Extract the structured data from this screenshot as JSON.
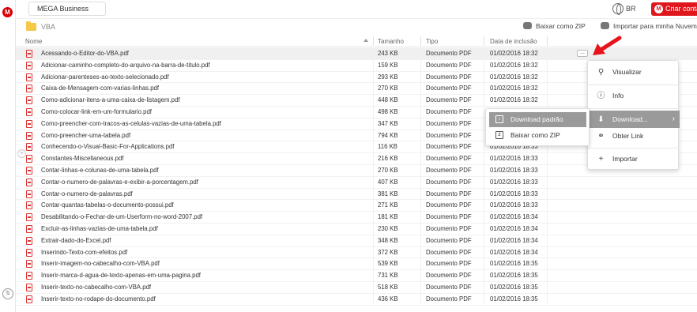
{
  "app": {
    "logo_letter": "M"
  },
  "topbar": {
    "account_tab": "MEGA Business",
    "language": "BR",
    "create_account": "Criar conta"
  },
  "breadcrumb": {
    "folder": "VBA"
  },
  "actions": {
    "download_zip": "Baixar como ZIP",
    "import": "Importar para minha Nuvem"
  },
  "columns": {
    "name": "Nome",
    "size": "Tamanho",
    "type": "Tipo",
    "date": "Data de inclusão"
  },
  "files": [
    {
      "name": "Acessando-o-Editor-do-VBA.pdf",
      "size": "243 KB",
      "type": "Documento PDF",
      "date": "01/02/2016 18:32"
    },
    {
      "name": "Adicionar-caminho-completo-do-arquivo-na-barra-de-titulo.pdf",
      "size": "159 KB",
      "type": "Documento PDF",
      "date": "01/02/2016 18:32"
    },
    {
      "name": "Adicionar-parenteses-ao-texto-selecionado.pdf",
      "size": "293 KB",
      "type": "Documento PDF",
      "date": "01/02/2016 18:32"
    },
    {
      "name": "Caixa-de-Mensagem-com-varias-linhas.pdf",
      "size": "270 KB",
      "type": "Documento PDF",
      "date": "01/02/2016 18:32"
    },
    {
      "name": "Como-adicionar-itens-a-uma-caixa-de-listagem.pdf",
      "size": "448 KB",
      "type": "Documento PDF",
      "date": "01/02/2016 18:32"
    },
    {
      "name": "Como-colocar-link-em-um-formulario.pdf",
      "size": "498 KB",
      "type": "Documento PDF",
      "date": "01/02/2016 18:32"
    },
    {
      "name": "Como-preencher-com-tracos-as-celulas-vazias-de-uma-tabela.pdf",
      "size": "347 KB",
      "type": "Documento PDF",
      "date": "01/02/2016 18:32"
    },
    {
      "name": "Como-preencher-uma-tabela.pdf",
      "size": "794 KB",
      "type": "Documento PDF",
      "date": "01/02/2016 18:32"
    },
    {
      "name": "Conhecendo-o-Visual-Basic-For-Applications.pdf",
      "size": "116 KB",
      "type": "Documento PDF",
      "date": "01/02/2016 18:33"
    },
    {
      "name": "Constantes-Miscellaneous.pdf",
      "size": "216 KB",
      "type": "Documento PDF",
      "date": "01/02/2016 18:33"
    },
    {
      "name": "Contar-linhas-e-colunas-de-uma-tabela.pdf",
      "size": "270 KB",
      "type": "Documento PDF",
      "date": "01/02/2016 18:33"
    },
    {
      "name": "Contar-o-numero-de-palavras-e-exibir-a-porcentagem.pdf",
      "size": "407 KB",
      "type": "Documento PDF",
      "date": "01/02/2016 18:33"
    },
    {
      "name": "Contar-o-numero-de-palavras.pdf",
      "size": "381 KB",
      "type": "Documento PDF",
      "date": "01/02/2016 18:33"
    },
    {
      "name": "Contar-quantas-tabelas-o-documento-possui.pdf",
      "size": "271 KB",
      "type": "Documento PDF",
      "date": "01/02/2016 18:33"
    },
    {
      "name": "Desabilitando-o-Fechar-de-um-Userform-no-word-2007.pdf",
      "size": "181 KB",
      "type": "Documento PDF",
      "date": "01/02/2016 18:34"
    },
    {
      "name": "Excluir-as-linhas-vazias-de-uma-tabela.pdf",
      "size": "230 KB",
      "type": "Documento PDF",
      "date": "01/02/2016 18:34"
    },
    {
      "name": "Extrair-dado-do-Excel.pdf",
      "size": "348 KB",
      "type": "Documento PDF",
      "date": "01/02/2016 18:34"
    },
    {
      "name": "Inserindo-Texto-com-efeitos.pdf",
      "size": "372 KB",
      "type": "Documento PDF",
      "date": "01/02/2016 18:34"
    },
    {
      "name": "Inserir-imagem-no-cabecalho-com-VBA.pdf",
      "size": "539 KB",
      "type": "Documento PDF",
      "date": "01/02/2016 18:35"
    },
    {
      "name": "Inserir-marca-d-agua-de-texto-apenas-em-uma-pagina.pdf",
      "size": "731 KB",
      "type": "Documento PDF",
      "date": "01/02/2016 18:35"
    },
    {
      "name": "Inserir-texto-no-cabecalho-com-VBA.pdf",
      "size": "518 KB",
      "type": "Documento PDF",
      "date": "01/02/2016 18:35"
    },
    {
      "name": "Inserir-texto-no-rodape-do-documento.pdf",
      "size": "436 KB",
      "type": "Documento PDF",
      "date": "01/02/2016 18:35"
    }
  ],
  "row_menu": {
    "more_label": "..."
  },
  "context_menu": {
    "preview": "Visualizar",
    "info": "Info",
    "download": "Download...",
    "get_link": "Obter Link",
    "import": "Importar"
  },
  "download_submenu": {
    "standard": "Download padrão",
    "zip": "Baixar como ZIP"
  },
  "colors": {
    "brand": "#d90007",
    "highlight": "#9a9a9a",
    "arrow": "#e8141b",
    "folder": "#f5c84a"
  }
}
